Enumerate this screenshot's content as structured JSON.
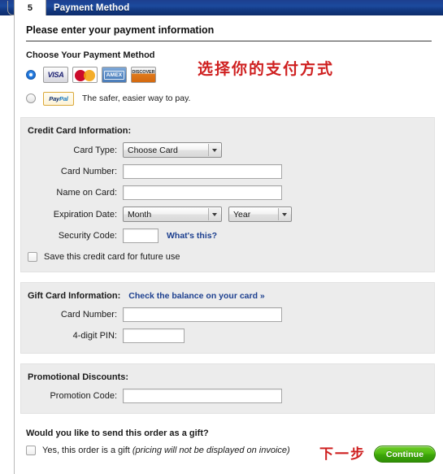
{
  "step": {
    "number": "5",
    "title": "Payment Method"
  },
  "heading": "Please enter your payment information",
  "choose_method": {
    "label": "Choose Your Payment Method",
    "card_option": {
      "selected": true,
      "logos": [
        {
          "name": "visa-logo",
          "text": "VISA"
        },
        {
          "name": "mastercard-logo",
          "text": ""
        },
        {
          "name": "amex-logo",
          "text": "AMEX"
        },
        {
          "name": "discover-logo",
          "text": "DISCOVER"
        }
      ]
    },
    "paypal_option": {
      "selected": false,
      "logo_part1": "Pay",
      "logo_part2": "Pal",
      "tagline": "The safer, easier way to pay."
    }
  },
  "credit_card": {
    "title": "Credit Card Information:",
    "card_type_label": "Card Type:",
    "card_type_value": "Choose Card",
    "card_number_label": "Card Number:",
    "card_number_value": "",
    "name_on_card_label": "Name on Card:",
    "name_on_card_value": "",
    "expiration_label": "Expiration Date:",
    "month_value": "Month",
    "year_value": "Year",
    "security_code_label": "Security Code:",
    "security_code_value": "",
    "whats_this": "What's this?",
    "save_card_label": "Save this credit card for future use",
    "save_card_checked": false
  },
  "gift_card": {
    "title": "Gift Card Information:",
    "balance_link": "Check the balance on your card »",
    "card_number_label": "Card Number:",
    "card_number_value": "",
    "pin_label": "4-digit PIN:",
    "pin_value": ""
  },
  "promotional": {
    "title": "Promotional Discounts:",
    "promo_code_label": "Promotion Code:",
    "promo_code_value": ""
  },
  "gift_order": {
    "question": "Would you like to send this order as a gift?",
    "checkbox_label": "Yes, this order is a gift ",
    "checkbox_note": "(pricing will not be displayed on invoice)",
    "checked": false
  },
  "footer": {
    "continue_label": "Continue"
  },
  "annotations": {
    "choose_method_cn": "选择你的支付方式",
    "next_step_cn": "下一步"
  },
  "colors": {
    "header_blue": "#1c4a9e",
    "link_blue": "#1c3f8f",
    "panel_gray": "#ececec",
    "continue_green": "#4fbb10",
    "annotation_red": "#cf2020"
  }
}
